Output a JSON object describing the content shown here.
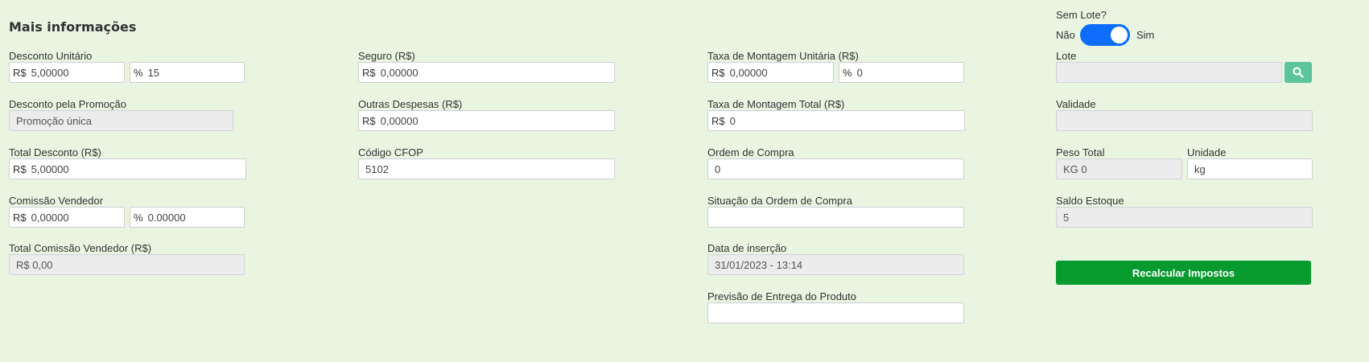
{
  "section_title": "Mais informações",
  "col1": {
    "desconto_unitario": {
      "label": "Desconto Unitário",
      "prefix": "R$",
      "value": "5,00000",
      "pct_prefix": "%",
      "pct_value": "15"
    },
    "desconto_promocao": {
      "label": "Desconto pela Promoção",
      "value": "Promoção única"
    },
    "total_desconto": {
      "label": "Total Desconto (R$)",
      "prefix": "R$",
      "value": "5,00000"
    },
    "comissao_vendedor": {
      "label": "Comissão Vendedor",
      "prefix": "R$",
      "value": "0,00000",
      "pct_prefix": "%",
      "pct_value": "0.00000"
    },
    "total_comissao": {
      "label": "Total Comissão Vendedor (R$)",
      "value": "R$ 0,00"
    }
  },
  "col2": {
    "seguro": {
      "label": "Seguro (R$)",
      "prefix": "R$",
      "value": "0,00000"
    },
    "outras_despesas": {
      "label": "Outras Despesas (R$)",
      "prefix": "R$",
      "value": "0,00000"
    },
    "cfop": {
      "label": "Código CFOP",
      "value": "5102"
    }
  },
  "col3": {
    "taxa_montagem_unit": {
      "label": "Taxa de Montagem Unitária (R$)",
      "prefix": "R$",
      "value": "0,00000",
      "pct_prefix": "%",
      "pct_value": "0"
    },
    "taxa_montagem_total": {
      "label": "Taxa de Montagem Total (R$)",
      "prefix": "R$",
      "value": "0"
    },
    "ordem_compra": {
      "label": "Ordem de Compra",
      "value": "0"
    },
    "situacao_ordem": {
      "label": "Situação da Ordem de Compra",
      "value": ""
    },
    "data_insercao": {
      "label": "Data de inserção",
      "value": "31/01/2023 - 13:14"
    },
    "previsao_entrega": {
      "label": "Previsão de Entrega do Produto",
      "value": ""
    }
  },
  "col4": {
    "sem_lote": {
      "label": "Sem Lote?",
      "off_label": "Não",
      "on_label": "Sim",
      "checked": true
    },
    "lote": {
      "label": "Lote",
      "value": ""
    },
    "validade": {
      "label": "Validade",
      "value": ""
    },
    "peso_total": {
      "label": "Peso Total",
      "value": "KG 0"
    },
    "unidade": {
      "label": "Unidade",
      "value": "kg"
    },
    "saldo_estoque": {
      "label": "Saldo Estoque",
      "value": "5"
    },
    "recalcular_label": "Recalcular Impostos"
  },
  "colors": {
    "background": "#e9f5e1",
    "toggle": "#0d6efd",
    "search_button": "#5cc49b",
    "primary_button": "#079b2f"
  },
  "icons": {
    "search": "search-icon"
  }
}
